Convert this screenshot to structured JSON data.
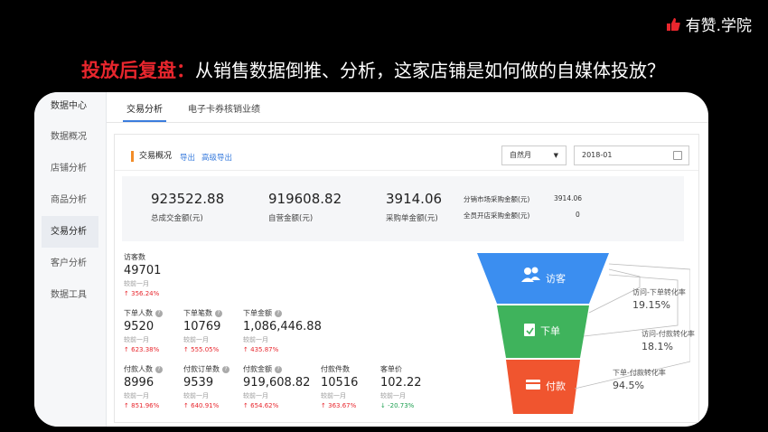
{
  "brand": {
    "name": "有赞.学院"
  },
  "headline": {
    "accent": "投放后复盘：",
    "rest": "从销售数据倒推、分析，这家店铺是如何做的自媒体投放？"
  },
  "sidebar": {
    "items": [
      {
        "label": "数据中心"
      },
      {
        "label": "数据概况"
      },
      {
        "label": "店铺分析"
      },
      {
        "label": "商品分析"
      },
      {
        "label": "交易分析"
      },
      {
        "label": "客户分析"
      },
      {
        "label": "数据工具"
      }
    ],
    "active_index": 4
  },
  "tabs": [
    {
      "label": "交易分析"
    },
    {
      "label": "电子卡券核销业绩"
    }
  ],
  "panel": {
    "title": "交易概况",
    "export_label": "导出",
    "advanced_export_label": "高级导出",
    "period_select": "自然月",
    "date_value": "2018-01"
  },
  "summary": {
    "stats": [
      {
        "value": "923522.88",
        "label": "总成交金额(元)"
      },
      {
        "value": "919608.82",
        "label": "自营金额(元)"
      },
      {
        "value": "3914.06",
        "label": "采购单金额(元)"
      }
    ],
    "sub_rows": [
      {
        "label": "分销市场采购金额(元)",
        "value": "3914.06"
      },
      {
        "label": "全员开店采购金额(元)",
        "value": "0"
      }
    ]
  },
  "metrics": {
    "compare_label": "较前一月",
    "visitors": {
      "title": "访客数",
      "value": "49701",
      "change": "356.24%",
      "direction": "up"
    },
    "orders": [
      {
        "title": "下单人数",
        "value": "9520",
        "change": "623.38%",
        "direction": "up"
      },
      {
        "title": "下单笔数",
        "value": "10769",
        "change": "555.05%",
        "direction": "up"
      },
      {
        "title": "下单金额",
        "value": "1,086,446.88",
        "change": "435.87%",
        "direction": "up"
      }
    ],
    "payments": [
      {
        "title": "付款人数",
        "value": "8996",
        "change": "851.96%",
        "direction": "up"
      },
      {
        "title": "付款订单数",
        "value": "9539",
        "change": "640.91%",
        "direction": "up"
      },
      {
        "title": "付款金额",
        "value": "919,608.82",
        "change": "654.62%",
        "direction": "up"
      },
      {
        "title": "付款件数",
        "value": "10516",
        "change": "363.67%",
        "direction": "up"
      },
      {
        "title": "客单价",
        "value": "102.22",
        "change": "-20.73%",
        "direction": "down"
      }
    ]
  },
  "funnel": {
    "stages": [
      {
        "label": "访客",
        "color": "#3b8ef0"
      },
      {
        "label": "下单",
        "color": "#3fb35c"
      },
      {
        "label": "付款",
        "color": "#f0552f"
      }
    ],
    "conversions": [
      {
        "label": "访问-下单转化率",
        "value": "19.15%"
      },
      {
        "label": "访问-付款转化率",
        "value": "18.1%"
      },
      {
        "label": "下单-付款转化率",
        "value": "94.5%"
      }
    ]
  }
}
